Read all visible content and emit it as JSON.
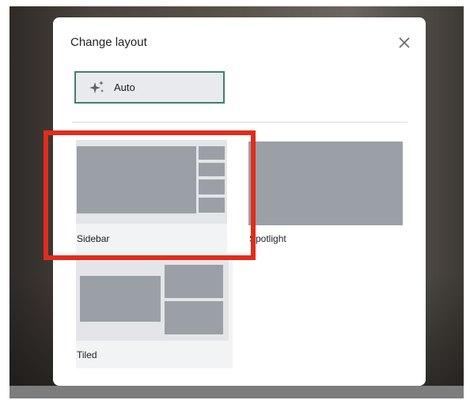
{
  "dialog": {
    "title": "Change layout",
    "close_icon": "close-icon",
    "auto_button": {
      "label": "Auto",
      "icon": "sparkle-icon"
    },
    "options": [
      {
        "label": "Sidebar",
        "selected": false
      },
      {
        "label": "Spotlight",
        "selected": false
      },
      {
        "label": "Tiled",
        "selected": false
      }
    ]
  },
  "colors": {
    "auto_border": "#3f7f72",
    "highlight_box": "#e02d1b",
    "thumbnail_block": "#9aa0a6"
  }
}
